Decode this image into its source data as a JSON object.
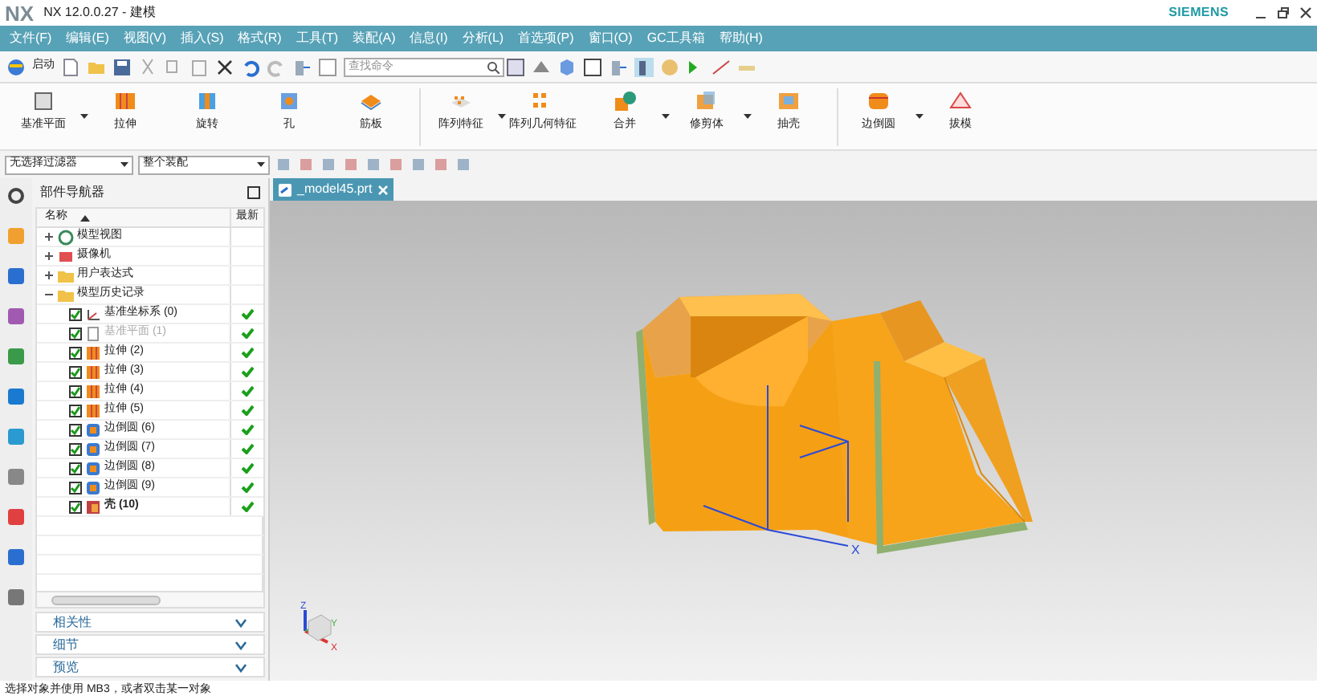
{
  "window": {
    "logo": "NX",
    "title": "NX 12.0.0.27 - 建模",
    "brand": "SIEMENS"
  },
  "menu": [
    "文件(F)",
    "编辑(E)",
    "视图(V)",
    "插入(S)",
    "格式(R)",
    "工具(T)",
    "装配(A)",
    "信息(I)",
    "分析(L)",
    "首选项(P)",
    "窗口(O)",
    "GC工具箱",
    "帮助(H)"
  ],
  "toolbar": {
    "start": "启动",
    "search": {
      "placeholder": "查找命令"
    }
  },
  "ribbon": [
    {
      "label": "基准平面",
      "kind": "plane",
      "dropdown": true
    },
    {
      "label": "拉伸",
      "kind": "extrude",
      "dropdown": false
    },
    {
      "label": "旋转",
      "kind": "revolve",
      "dropdown": false
    },
    {
      "label": "孔",
      "kind": "hole",
      "dropdown": false
    },
    {
      "label": "筋板",
      "kind": "rib",
      "dropdown": false
    },
    {
      "label": "阵列特征",
      "kind": "pattern",
      "dropdown": true
    },
    {
      "label": "阵列几何特征",
      "kind": "geompattern",
      "dropdown": false
    },
    {
      "label": "合并",
      "kind": "unite",
      "dropdown": true
    },
    {
      "label": "修剪体",
      "kind": "trim",
      "dropdown": true
    },
    {
      "label": "抽壳",
      "kind": "shell",
      "dropdown": false
    },
    {
      "label": "边倒圆",
      "kind": "blend",
      "dropdown": true
    },
    {
      "label": "拔模",
      "kind": "draft",
      "dropdown": false
    }
  ],
  "selection_bar": {
    "filter": "无选择过滤器",
    "scope": "整个装配"
  },
  "navigator": {
    "title": "部件导航器",
    "columns": [
      "名称",
      "最新"
    ],
    "tree": [
      {
        "label": "模型视图",
        "kind": "views",
        "expanded": false
      },
      {
        "label": "摄像机",
        "kind": "camera",
        "expanded": false
      },
      {
        "label": "用户表达式",
        "kind": "folder",
        "expanded": false
      },
      {
        "label": "模型历史记录",
        "kind": "folder",
        "expanded": true,
        "children": [
          {
            "label": "基准坐标系 (0)",
            "kind": "csys",
            "checked": true,
            "suppressed": false,
            "current": false,
            "latest": true
          },
          {
            "label": "基准平面 (1)",
            "kind": "plane",
            "checked": true,
            "suppressed": true,
            "current": false,
            "latest": true
          },
          {
            "label": "拉伸 (2)",
            "kind": "extrude",
            "checked": true,
            "suppressed": false,
            "current": false,
            "latest": true
          },
          {
            "label": "拉伸 (3)",
            "kind": "extrude",
            "checked": true,
            "suppressed": false,
            "current": false,
            "latest": true
          },
          {
            "label": "拉伸 (4)",
            "kind": "extrude",
            "checked": true,
            "suppressed": false,
            "current": false,
            "latest": true
          },
          {
            "label": "拉伸 (5)",
            "kind": "extrude",
            "checked": true,
            "suppressed": false,
            "current": false,
            "latest": true
          },
          {
            "label": "边倒圆 (6)",
            "kind": "blend",
            "checked": true,
            "suppressed": false,
            "current": false,
            "latest": true
          },
          {
            "label": "边倒圆 (7)",
            "kind": "blend",
            "checked": true,
            "suppressed": false,
            "current": false,
            "latest": true
          },
          {
            "label": "边倒圆 (8)",
            "kind": "blend",
            "checked": true,
            "suppressed": false,
            "current": false,
            "latest": true
          },
          {
            "label": "边倒圆 (9)",
            "kind": "blend",
            "checked": true,
            "suppressed": false,
            "current": false,
            "latest": true
          },
          {
            "label": "壳 (10)",
            "kind": "shell",
            "checked": true,
            "suppressed": false,
            "current": true,
            "latest": true
          }
        ]
      }
    ],
    "panels": [
      {
        "label": "相关性",
        "expanded": false
      },
      {
        "label": "细节",
        "expanded": false
      },
      {
        "label": "预览",
        "expanded": false
      }
    ]
  },
  "document_tab": {
    "label": "_model45.prt",
    "selected": true
  },
  "viewport": {
    "csys_labels": [
      "X"
    ],
    "triad_labels": [
      "Z",
      "Y",
      "X"
    ]
  },
  "status_bar": {
    "text": "选择对象并使用 MB3，或者双击某一对象"
  }
}
